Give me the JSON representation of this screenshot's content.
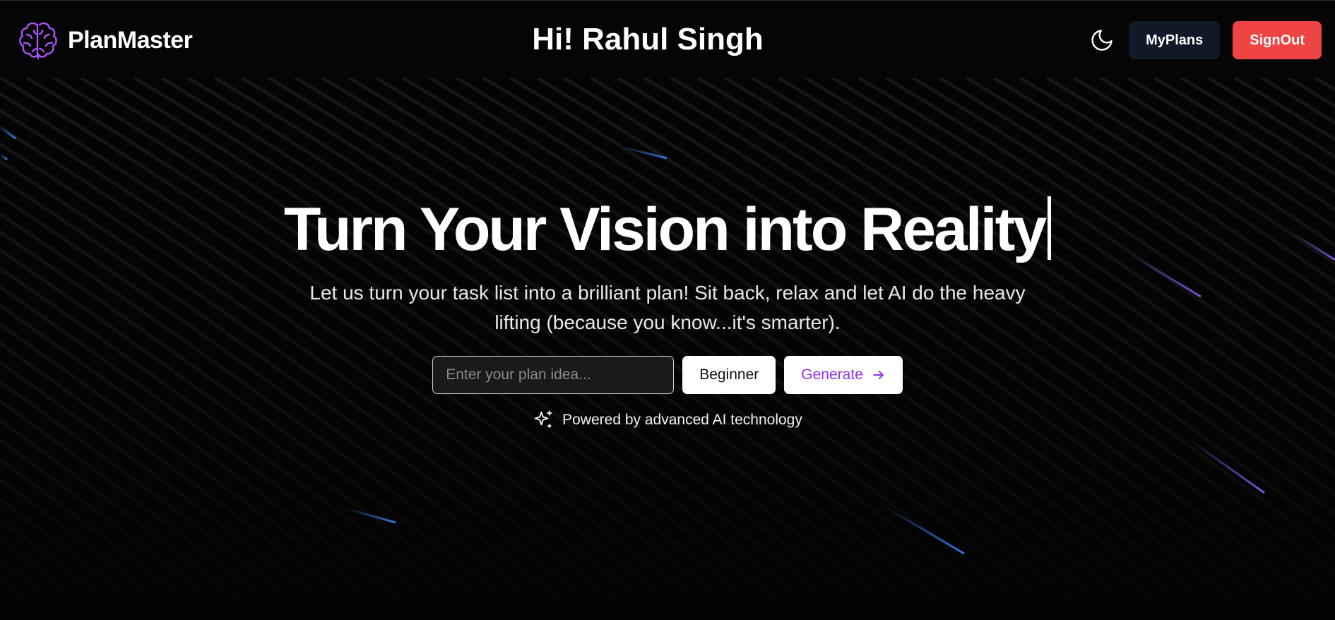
{
  "app": {
    "name": "PlanMaster",
    "logo_icon": "brain-icon",
    "accent_color": "#a855f7"
  },
  "header": {
    "greeting": "Hi! Rahul Singh",
    "theme_icon": "moon-icon",
    "myplans_label": "MyPlans",
    "signout_label": "SignOut",
    "myplans_color": "#111827",
    "signout_color": "#ef4444"
  },
  "hero": {
    "title": "Turn Your Vision into Reality",
    "subtitle": "Let us turn your task list into a brilliant plan! Sit back, relax and let AI do the heavy lifting (because you know...it's smarter).",
    "input_placeholder": "Enter your plan idea...",
    "input_value": "",
    "level_label": "Beginner",
    "generate_label": "Generate",
    "generate_icon": "arrow-right-icon",
    "generate_color": "#9333ea",
    "powered_icon": "sparkles-icon",
    "powered_text": "Powered by advanced AI technology"
  }
}
